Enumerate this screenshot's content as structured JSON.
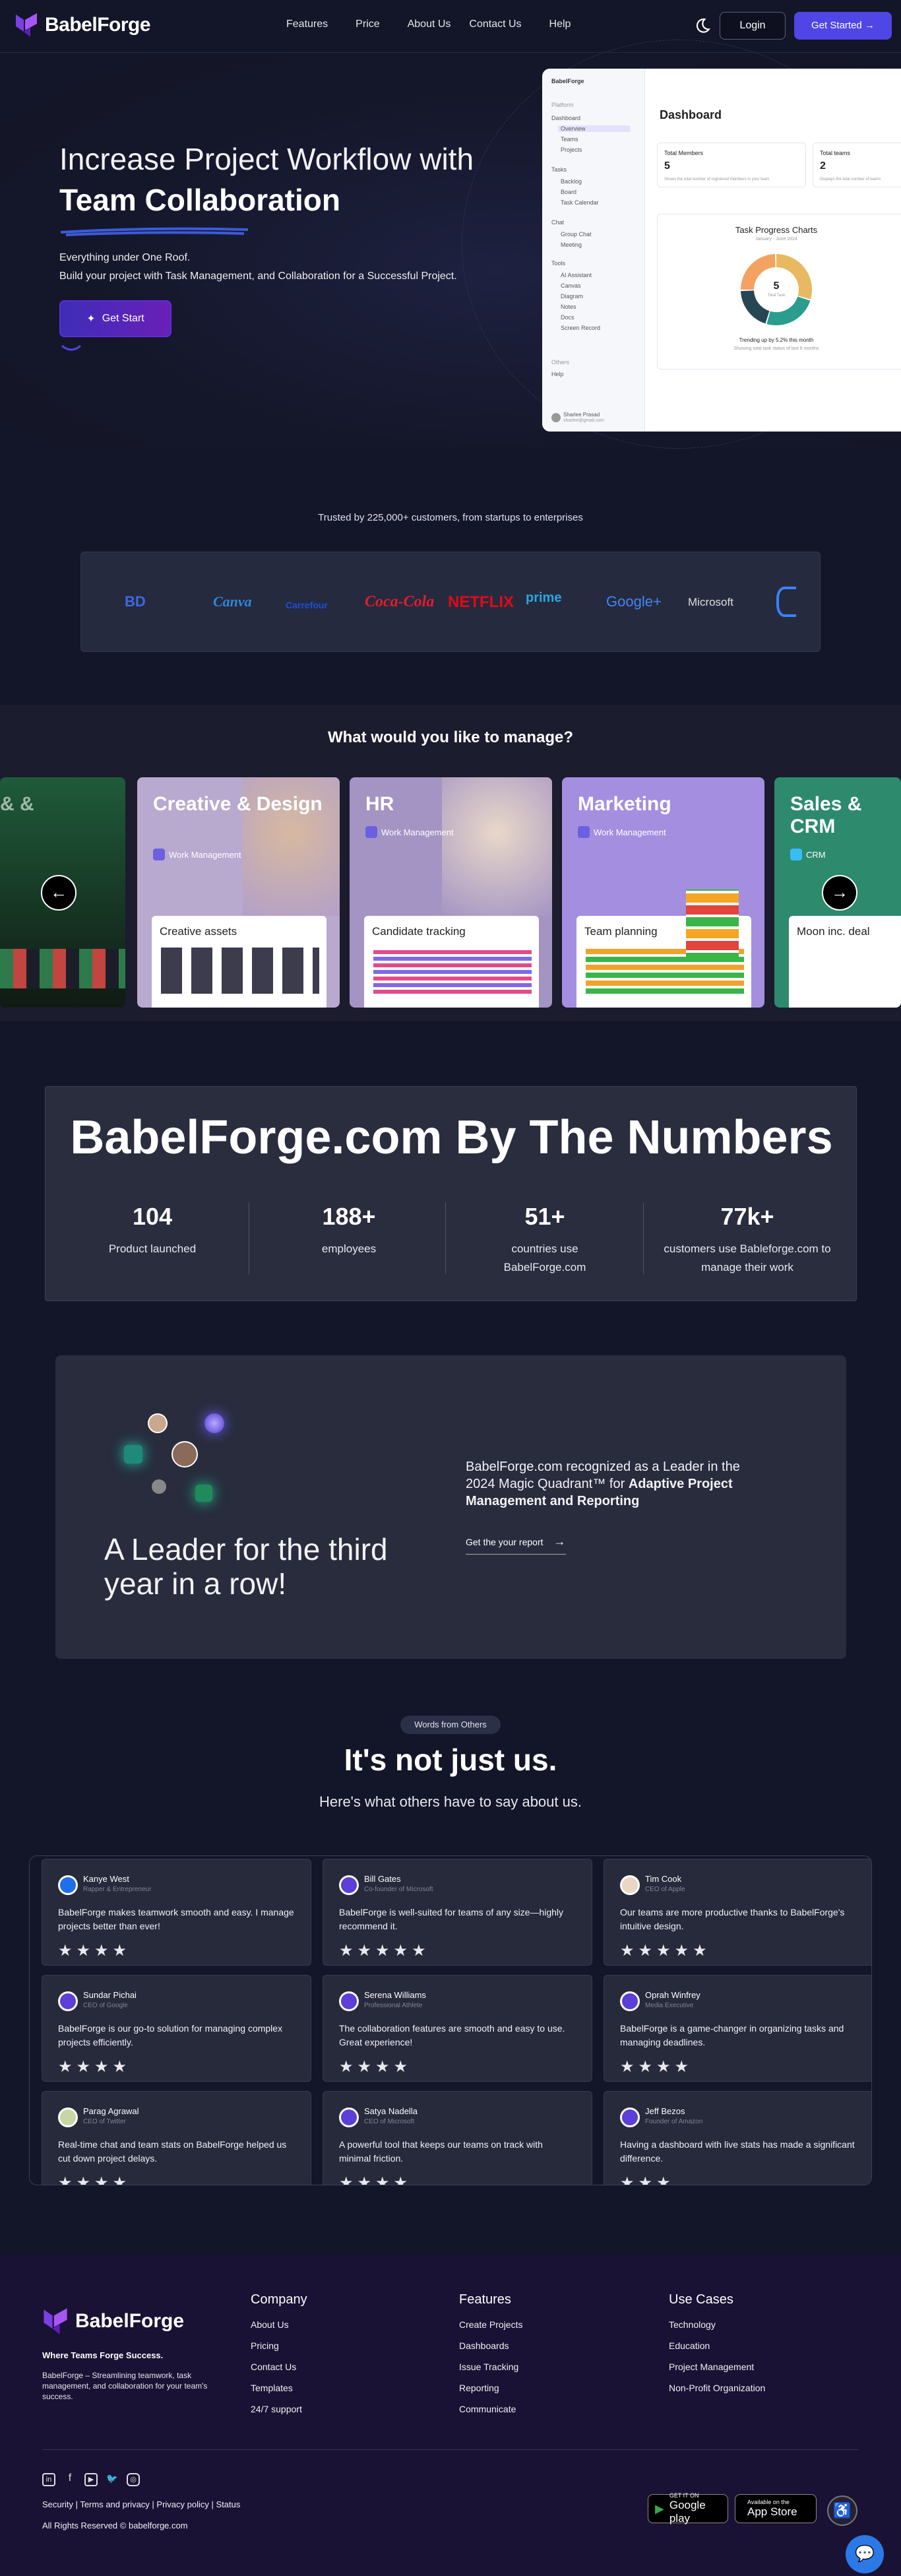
{
  "nav": {
    "brand": "BabelForge",
    "links": [
      "Features",
      "Price",
      "About Us",
      "Contact Us",
      "Help"
    ],
    "login": "Login",
    "get_started": "Get Started"
  },
  "hero": {
    "title_light": "Increase Project Workflow with",
    "title_bold": "Team Collaboration",
    "line1": "Everything under One Roof.",
    "line2": "Build your project with Task Management, and Collaboration for a Successful Project.",
    "cta": "Get Start"
  },
  "dashboard": {
    "brand": "BabelForge",
    "section": "Platform",
    "sidebar": [
      "Dashboard",
      "Overview",
      "Teams",
      "Projects",
      "Tasks",
      "Backlog",
      "Board",
      "Task Calendar",
      "Chat",
      "Group Chat",
      "Meeting",
      "Tools",
      "AI Assistant",
      "Canvas",
      "Diagram",
      "Notes",
      "Docs",
      "Screen Record",
      "Others",
      "Help"
    ],
    "user_name": "Sharlee Prasad",
    "user_email": "sharlee@gmail.com",
    "title": "Dashboard",
    "stat1_label": "Total Members",
    "stat1_value": "5",
    "stat1_note": "Shows the total number of registered members in your team",
    "stat2_label": "Total teams",
    "stat2_value": "2",
    "stat2_note": "Displays the total number of teams",
    "chart_title": "Task Progress Charts",
    "chart_range": "January - June 2024",
    "chart_center": "5",
    "chart_center_label": "Total Task",
    "chart_foot1": "Trending up by 5.2% this month",
    "chart_foot2": "Showing total task status of last 6 months",
    "donut_colors": [
      "#e8b960",
      "#2a9d8f",
      "#264653",
      "#f4a261"
    ]
  },
  "trusted": {
    "text": "Trusted by 225,000+ customers, from startups to enterprises",
    "logos": [
      "BD",
      "Canva",
      "Carrefour",
      "Coca-Cola",
      "NETFLIX",
      "prime",
      "Google+",
      "Microsoft"
    ]
  },
  "manage": {
    "title": "What would you like to manage?",
    "cards": [
      {
        "title": "Creative & Design",
        "tag": "Work Management",
        "pane": "Creative assets",
        "color": "#b8a9cf"
      },
      {
        "title": "HR",
        "tag": "Work Management",
        "pane": "Candidate tracking",
        "color": "#a494c4"
      },
      {
        "title": "Marketing",
        "tag": "Work Management",
        "pane": "Team planning",
        "color": "#a48ee0"
      },
      {
        "title": "Sales & CRM",
        "tag": "CRM",
        "pane": "Moon inc. deal",
        "color": "#2d8a6c"
      }
    ]
  },
  "numbers": {
    "title": "BabelForge.com By The Numbers",
    "stats": [
      {
        "value": "104",
        "label": "Product launched"
      },
      {
        "value": "188+",
        "label": "employees"
      },
      {
        "value": "51+",
        "label": "countries use BabelForge.com"
      },
      {
        "value": "77k+",
        "label": "customers use Bableforge.com to manage their work"
      }
    ]
  },
  "leader": {
    "heading": "A Leader for the third year in a row!",
    "text_plain": "BabelForge.com recognized as a Leader in the 2024 Magic Quadrant™ for",
    "text_bold": "Adaptive Project Management and Reporting",
    "link": "Get the your report"
  },
  "testimonials": {
    "pill": "Words from Others",
    "title": "It's not just us.",
    "subtitle": "Here's what others have to say about us.",
    "items": [
      {
        "name": "Kanye West",
        "role": "Rapper & Entrepreneur",
        "quote": "BabelForge makes teamwork smooth and easy. I manage projects better than ever!",
        "stars": "★★★★"
      },
      {
        "name": "Bill Gates",
        "role": "Co-founder of Microsoft",
        "quote": "BabelForge is well-suited for teams of any size—highly recommend it.",
        "stars": "★★★★★"
      },
      {
        "name": "Tim Cook",
        "role": "CEO of Apple",
        "quote": "Our teams are more productive thanks to BabelForge's intuitive design.",
        "stars": "★★★★★"
      },
      {
        "name": "Sundar Pichai",
        "role": "CEO of Google",
        "quote": "BabelForge is our go-to solution for managing complex projects efficiently.",
        "stars": "★★★★"
      },
      {
        "name": "Serena Williams",
        "role": "Professional Athlete",
        "quote": "The collaboration features are smooth and easy to use. Great experience!",
        "stars": "★★★★"
      },
      {
        "name": "Oprah Winfrey",
        "role": "Media Executive",
        "quote": "BabelForge is a game-changer in organizing tasks and managing deadlines.",
        "stars": "★★★★"
      },
      {
        "name": "Parag Agrawal",
        "role": "CEO of Twitter",
        "quote": "Real-time chat and team stats on BabelForge helped us cut down project delays.",
        "stars": "★★★★"
      },
      {
        "name": "Satya Nadella",
        "role": "CEO of Microsoft",
        "quote": "A powerful tool that keeps our teams on track with minimal friction.",
        "stars": "★★★★"
      },
      {
        "name": "Jeff Bezos",
        "role": "Founder of Amazon",
        "quote": "Having a dashboard with live stats has made a significant difference.",
        "stars": "★★★"
      }
    ]
  },
  "footer": {
    "brand": "BabelForge",
    "tagline": "Where Teams Forge Success.",
    "desc": "BabelForge – Streamlining teamwork, task management, and collaboration for your team's success.",
    "company_title": "Company",
    "company": [
      "About Us",
      "Pricing",
      "Contact Us",
      "Templates",
      "24/7 support"
    ],
    "features_title": "Features",
    "features": [
      "Create Projects",
      "Dashboards",
      "Issue Tracking",
      "Reporting",
      "Communicate"
    ],
    "usecases_title": "Use Cases",
    "usecases": [
      "Technology",
      "Education",
      "Project Management",
      "Non-Profit Organization"
    ],
    "legal": "Security | Terms and privacy | Privacy policy | Status",
    "copyright": "All Rights Reserved © babelforge.com",
    "gplay_small": "GET IT ON",
    "gplay": "Google play",
    "appstore_small": "Available on the",
    "appstore": "App Store"
  }
}
